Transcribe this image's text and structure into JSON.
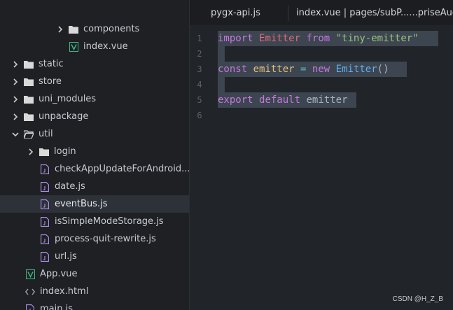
{
  "tabs": [
    {
      "label": "pygx-api.js"
    },
    {
      "label": "index.vue | pages/subP......priseAudit"
    }
  ],
  "tree": [
    {
      "label": "components",
      "type": "folder",
      "chevron": "right"
    },
    {
      "label": "index.vue",
      "type": "vue"
    },
    {
      "label": "static",
      "type": "folder",
      "chevron": "right"
    },
    {
      "label": "store",
      "type": "folder",
      "chevron": "right"
    },
    {
      "label": "uni_modules",
      "type": "folder",
      "chevron": "right"
    },
    {
      "label": "unpackage",
      "type": "folder",
      "chevron": "right"
    },
    {
      "label": "util",
      "type": "folder-open",
      "chevron": "down"
    },
    {
      "label": "login",
      "type": "folder",
      "chevron": "right"
    },
    {
      "label": "checkAppUpdateForAndroid...",
      "type": "js"
    },
    {
      "label": "date.js",
      "type": "js"
    },
    {
      "label": "eventBus.js",
      "type": "js",
      "selected": true
    },
    {
      "label": "isSimpleModeStorage.js",
      "type": "js"
    },
    {
      "label": "process-quit-rewrite.js",
      "type": "js"
    },
    {
      "label": "url.js",
      "type": "js"
    },
    {
      "label": "App.vue",
      "type": "vue"
    },
    {
      "label": "index.html",
      "type": "html"
    },
    {
      "label": "main.js",
      "type": "js"
    }
  ],
  "code": {
    "line_numbers": [
      "1",
      "2",
      "3",
      "4",
      "5",
      "6"
    ],
    "line1": {
      "t1": "import",
      "t2": " ",
      "t3": "Emitter",
      "t4": " ",
      "t5": "from",
      "t6": " ",
      "t7": "\"tiny-emitter\""
    },
    "line3": {
      "t1": "const",
      "t2": " ",
      "t3": "emitter",
      "t4": " ",
      "t5": "=",
      "t6": " ",
      "t7": "new",
      "t8": " ",
      "t9": "Emitter",
      "t10": "()"
    },
    "line5": {
      "t1": "export",
      "t2": " ",
      "t3": "default",
      "t4": " ",
      "t5": "emitter"
    }
  },
  "watermark": "CSDN @H_Z_B",
  "colors": {
    "folder": "#d9d9d9",
    "vue": "#41b883",
    "js": "#b392f0",
    "selection": "#3c4550"
  }
}
